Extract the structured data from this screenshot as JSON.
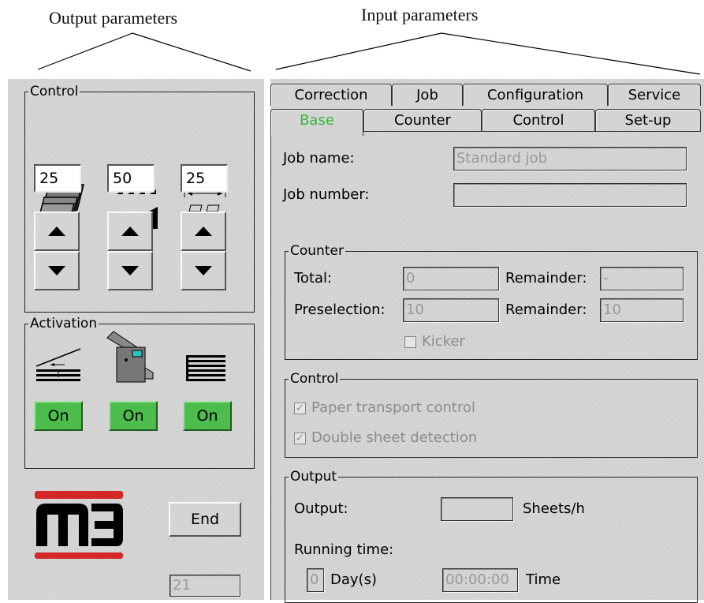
{
  "captions": {
    "output": "Output parameters",
    "input": "Input parameters"
  },
  "left": {
    "control_label": "Control",
    "values": [
      "25",
      "50",
      "25"
    ],
    "activation_label": "Activation",
    "on_labels": [
      "On",
      "On",
      "On"
    ],
    "logo_icon": "m3-logo",
    "end_label": "End",
    "counter_value": "21"
  },
  "tabs": {
    "row1": [
      "Correction",
      "Job",
      "Configuration",
      "Service"
    ],
    "row2": [
      "Base",
      "Counter",
      "Control",
      "Set-up"
    ],
    "active": "Base",
    "active_color": "#38b838"
  },
  "base": {
    "job_name_label": "Job name:",
    "job_name_value": "Standard job",
    "job_number_label": "Job number:",
    "job_number_value": "",
    "counter": {
      "title": "Counter",
      "total_label": "Total:",
      "total_value": "0",
      "remainder_label": "Remainder:",
      "remainder_value": "-",
      "preselection_label": "Preselection:",
      "preselection_value": "10",
      "remainder2_label": "Remainder:",
      "remainder2_value": "10",
      "kicker_label": "Kicker"
    },
    "control": {
      "title": "Control",
      "paper_transport_label": "Paper transport control",
      "double_sheet_label": "Double sheet detection"
    },
    "output": {
      "title": "Output",
      "output_label": "Output:",
      "output_value": "",
      "sheets_unit": "Sheets/h",
      "running_time_label": "Running time:",
      "days_value": "0",
      "days_label": "Day(s)",
      "time_value": "00:00:00",
      "time_label": "Time"
    }
  }
}
